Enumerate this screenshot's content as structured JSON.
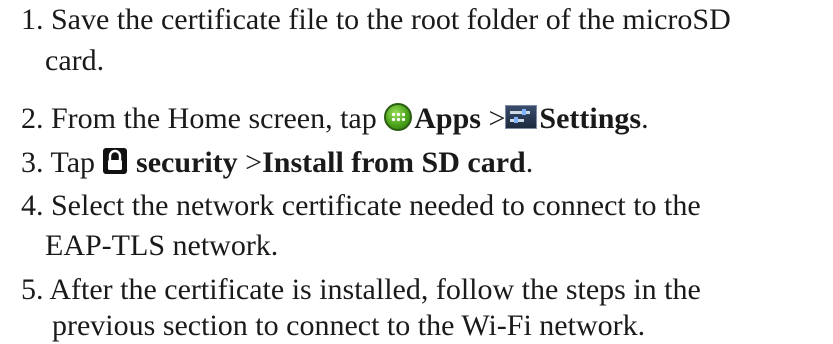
{
  "steps": [
    {
      "line1": "1. Save the certificate file to the root folder of the microSD",
      "line2": "card."
    },
    {
      "pre": "2. From the Home screen, tap ",
      "apps_label": "Apps",
      "sep": " >",
      "settings_label": "Settings",
      "end": "."
    },
    {
      "pre": "3. Tap ",
      "security_label": "security",
      "sep": " >",
      "install_label": "Install from SD card",
      "end": "."
    },
    {
      "line1": "4. Select the network certificate needed to connect to the",
      "line2": "EAP-TLS network."
    },
    {
      "line1": "5. After the certificate is installed, follow the steps in the",
      "line2": "previous section to connect to the Wi-Fi network."
    }
  ],
  "icons": {
    "apps": "apps-grid-icon",
    "settings": "settings-sliders-icon",
    "security": "lock-icon"
  },
  "colors": {
    "text": "#1a1a1a",
    "apps_icon": "#4aa31c",
    "settings_icon": "#1d2a3e"
  }
}
